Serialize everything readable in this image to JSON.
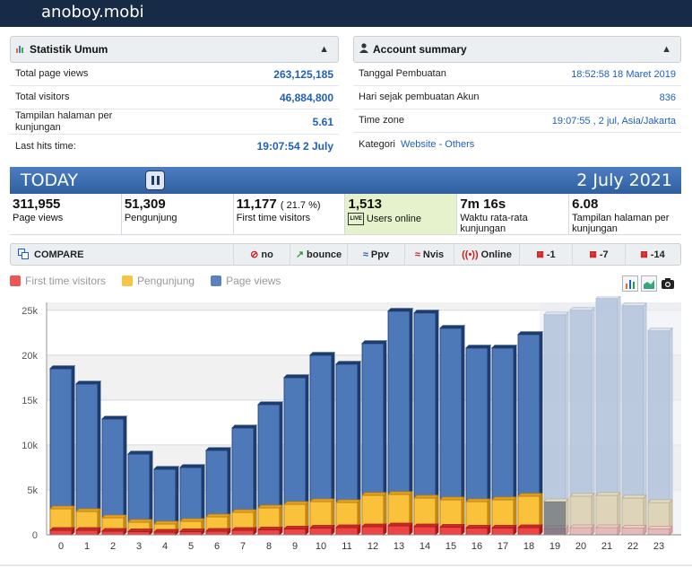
{
  "site": {
    "title": "anoboy.mobi"
  },
  "stats_panel": {
    "title": "Statistik Umum",
    "rows": [
      {
        "label": "Total page views",
        "value": "263,125,185"
      },
      {
        "label": "Total visitors",
        "value": "46,884,800"
      },
      {
        "label": "Tampilan halaman per kunjungan",
        "value": "5.61"
      },
      {
        "label": "Last hits time:",
        "value": "19:07:54 2 July"
      }
    ]
  },
  "account_panel": {
    "title": "Account summary",
    "rows": [
      {
        "label": "Tanggal Pembuatan",
        "value": "18:52:58 18 Maret 2019"
      },
      {
        "label": "Hari sejak pembuatan Akun",
        "value": "836"
      },
      {
        "label": "Time zone",
        "value": "19:07:55 , 2 jul, Asia/Jakarta"
      }
    ],
    "kategori_label": "Kategori",
    "kategori_value": "Website - Others"
  },
  "today": {
    "label": "TODAY",
    "date": "2 July 2021"
  },
  "stats": [
    {
      "value": "311,955",
      "extra": "",
      "caption": "Page views"
    },
    {
      "value": "51,309",
      "extra": "",
      "caption": "Pengunjung"
    },
    {
      "value": "11,177",
      "extra": "( 21.7 %)",
      "caption": "First time visitors"
    },
    {
      "value": "1,513",
      "extra": "",
      "caption": "Users online",
      "badge": "LIVE"
    },
    {
      "value": "7m 16s",
      "extra": "",
      "caption": "Waktu rata-rata kunjungan"
    },
    {
      "value": "6.08",
      "extra": "",
      "caption": "Tampilan halaman per kunjungan"
    }
  ],
  "compare": {
    "label": "COMPARE",
    "options": [
      {
        "label": "no",
        "icon": "no-icon",
        "color": "#cc2222"
      },
      {
        "label": "bounce",
        "icon": "bounce-icon",
        "color": "#2e9e2e"
      },
      {
        "label": "Ppv",
        "icon": "ppv-chart-icon",
        "color": "#1f5fbd"
      },
      {
        "label": "Nvis",
        "icon": "nvis-chart-icon",
        "color": "#cc2222"
      },
      {
        "label": "Online",
        "icon": "online-icon",
        "color": "#cc2222"
      },
      {
        "label": "-1",
        "icon": "calendar-icon",
        "color": "#cc2222"
      },
      {
        "label": "-7",
        "icon": "calendar-icon",
        "color": "#cc2222"
      },
      {
        "label": "-14",
        "icon": "calendar-icon",
        "color": "#cc2222"
      }
    ]
  },
  "legend": [
    {
      "label": "First time visitors",
      "color": "#ee5555"
    },
    {
      "label": "Pengunjung",
      "color": "#f7c541"
    },
    {
      "label": "Page views",
      "color": "#5b82bf"
    }
  ],
  "chart_data": {
    "type": "bar",
    "categories": [
      "0",
      "1",
      "2",
      "3",
      "4",
      "5",
      "6",
      "7",
      "8",
      "9",
      "10",
      "11",
      "12",
      "13",
      "14",
      "15",
      "16",
      "17",
      "18",
      "19",
      "20",
      "21",
      "22",
      "23"
    ],
    "series": [
      {
        "name": "Page views",
        "values": [
          18500,
          16800,
          12900,
          9000,
          7300,
          7500,
          9400,
          11900,
          14500,
          17500,
          20000,
          19000,
          21300,
          24900,
          24700,
          23000,
          20800,
          20800,
          22300,
          24500,
          25000,
          26300,
          25500,
          22700
        ]
      },
      {
        "name": "Pengunjung",
        "values": [
          2900,
          2600,
          1900,
          1400,
          1200,
          1500,
          2000,
          2500,
          3000,
          3400,
          3700,
          3600,
          4400,
          4500,
          4100,
          3900,
          3700,
          3900,
          4300,
          3700,
          4300,
          4400,
          4100,
          3600
        ]
      },
      {
        "name": "First time visitors",
        "values": [
          500,
          500,
          400,
          350,
          300,
          350,
          400,
          500,
          550,
          650,
          750,
          800,
          900,
          1000,
          900,
          850,
          750,
          750,
          800,
          700,
          800,
          800,
          750,
          650
        ]
      }
    ],
    "future_from_index": 19,
    "ylim": [
      0,
      25000
    ],
    "yticks": [
      "0",
      "5k",
      "10k",
      "15k",
      "20k",
      "25k"
    ],
    "xlabel": "",
    "ylabel": "",
    "grid": true,
    "legend_position": "top-left"
  }
}
